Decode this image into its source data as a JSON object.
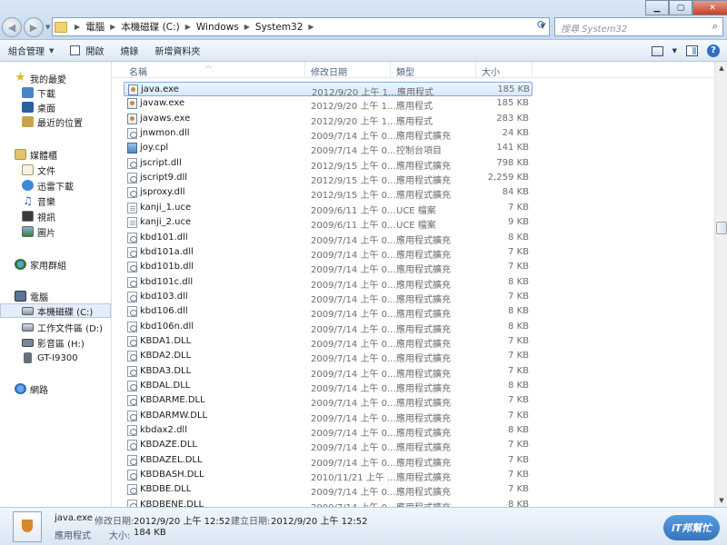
{
  "address": {
    "breadcrumb": [
      "電腦",
      "本機磁碟 (C:)",
      "Windows",
      "System32"
    ],
    "search_placeholder": "搜尋 System32"
  },
  "toolbar": {
    "organize": "組合管理",
    "open": "開啟",
    "burn": "燒錄",
    "new_folder": "新增資料夾"
  },
  "nav": {
    "favorites": "我的最愛",
    "downloads": "下載",
    "desktop": "桌面",
    "recent": "最近的位置",
    "libraries": "媒體櫃",
    "documents": "文件",
    "xunlei": "迅雷下載",
    "music": "音樂",
    "videos": "視訊",
    "pictures": "圖片",
    "homegroup": "家用群組",
    "computer": "電腦",
    "drive_c": "本機磁碟 (C:)",
    "drive_d": "工作文件區 (D:)",
    "drive_h": "影音區 (H:)",
    "phone": "GT-I9300",
    "network": "網路"
  },
  "columns": {
    "name": "名稱",
    "date": "修改日期",
    "type": "類型",
    "size": "大小"
  },
  "files": [
    {
      "name": "java.exe",
      "date": "2012/9/20 上午 1...",
      "type": "應用程式",
      "size": "185 KB",
      "icon": "exe",
      "selected": true
    },
    {
      "name": "javaw.exe",
      "date": "2012/9/20 上午 1...",
      "type": "應用程式",
      "size": "185 KB",
      "icon": "exe"
    },
    {
      "name": "javaws.exe",
      "date": "2012/9/20 上午 1...",
      "type": "應用程式",
      "size": "283 KB",
      "icon": "exe"
    },
    {
      "name": "jnwmon.dll",
      "date": "2009/7/14 上午 0...",
      "type": "應用程式擴充",
      "size": "24 KB",
      "icon": "dll"
    },
    {
      "name": "joy.cpl",
      "date": "2009/7/14 上午 0...",
      "type": "控制台項目",
      "size": "141 KB",
      "icon": "cpl"
    },
    {
      "name": "jscript.dll",
      "date": "2012/9/15 上午 0...",
      "type": "應用程式擴充",
      "size": "798 KB",
      "icon": "dll"
    },
    {
      "name": "jscript9.dll",
      "date": "2012/9/15 上午 0...",
      "type": "應用程式擴充",
      "size": "2,259 KB",
      "icon": "dll"
    },
    {
      "name": "jsproxy.dll",
      "date": "2012/9/15 上午 0...",
      "type": "應用程式擴充",
      "size": "84 KB",
      "icon": "dll"
    },
    {
      "name": "kanji_1.uce",
      "date": "2009/6/11 上午 0...",
      "type": "UCE 檔案",
      "size": "7 KB",
      "icon": "txt"
    },
    {
      "name": "kanji_2.uce",
      "date": "2009/6/11 上午 0...",
      "type": "UCE 檔案",
      "size": "9 KB",
      "icon": "txt"
    },
    {
      "name": "kbd101.dll",
      "date": "2009/7/14 上午 0...",
      "type": "應用程式擴充",
      "size": "8 KB",
      "icon": "dll"
    },
    {
      "name": "kbd101a.dll",
      "date": "2009/7/14 上午 0...",
      "type": "應用程式擴充",
      "size": "7 KB",
      "icon": "dll"
    },
    {
      "name": "kbd101b.dll",
      "date": "2009/7/14 上午 0...",
      "type": "應用程式擴充",
      "size": "7 KB",
      "icon": "dll"
    },
    {
      "name": "kbd101c.dll",
      "date": "2009/7/14 上午 0...",
      "type": "應用程式擴充",
      "size": "8 KB",
      "icon": "dll"
    },
    {
      "name": "kbd103.dll",
      "date": "2009/7/14 上午 0...",
      "type": "應用程式擴充",
      "size": "7 KB",
      "icon": "dll"
    },
    {
      "name": "kbd106.dll",
      "date": "2009/7/14 上午 0...",
      "type": "應用程式擴充",
      "size": "8 KB",
      "icon": "dll"
    },
    {
      "name": "kbd106n.dll",
      "date": "2009/7/14 上午 0...",
      "type": "應用程式擴充",
      "size": "8 KB",
      "icon": "dll"
    },
    {
      "name": "KBDA1.DLL",
      "date": "2009/7/14 上午 0...",
      "type": "應用程式擴充",
      "size": "7 KB",
      "icon": "dll"
    },
    {
      "name": "KBDA2.DLL",
      "date": "2009/7/14 上午 0...",
      "type": "應用程式擴充",
      "size": "7 KB",
      "icon": "dll"
    },
    {
      "name": "KBDA3.DLL",
      "date": "2009/7/14 上午 0...",
      "type": "應用程式擴充",
      "size": "7 KB",
      "icon": "dll"
    },
    {
      "name": "KBDAL.DLL",
      "date": "2009/7/14 上午 0...",
      "type": "應用程式擴充",
      "size": "8 KB",
      "icon": "dll"
    },
    {
      "name": "KBDARME.DLL",
      "date": "2009/7/14 上午 0...",
      "type": "應用程式擴充",
      "size": "7 KB",
      "icon": "dll"
    },
    {
      "name": "KBDARMW.DLL",
      "date": "2009/7/14 上午 0...",
      "type": "應用程式擴充",
      "size": "7 KB",
      "icon": "dll"
    },
    {
      "name": "kbdax2.dll",
      "date": "2009/7/14 上午 0...",
      "type": "應用程式擴充",
      "size": "8 KB",
      "icon": "dll"
    },
    {
      "name": "KBDAZE.DLL",
      "date": "2009/7/14 上午 0...",
      "type": "應用程式擴充",
      "size": "7 KB",
      "icon": "dll"
    },
    {
      "name": "KBDAZEL.DLL",
      "date": "2009/7/14 上午 0...",
      "type": "應用程式擴充",
      "size": "7 KB",
      "icon": "dll"
    },
    {
      "name": "KBDBASH.DLL",
      "date": "2010/11/21 上午 ...",
      "type": "應用程式擴充",
      "size": "7 KB",
      "icon": "dll"
    },
    {
      "name": "KBDBE.DLL",
      "date": "2009/7/14 上午 0...",
      "type": "應用程式擴充",
      "size": "7 KB",
      "icon": "dll"
    },
    {
      "name": "KBDBENE.DLL",
      "date": "2009/7/14 上午 0...",
      "type": "應用程式擴充",
      "size": "8 KB",
      "icon": "dll"
    }
  ],
  "details": {
    "name": "java.exe",
    "type": "應用程式",
    "modified_label": "修改日期:",
    "modified": "2012/9/20 上午 12:52",
    "created_label": "建立日期:",
    "created": "2012/9/20 上午 12:52",
    "size_label": "大小:",
    "size": "184 KB"
  },
  "watermark": "iT邦幫忙"
}
